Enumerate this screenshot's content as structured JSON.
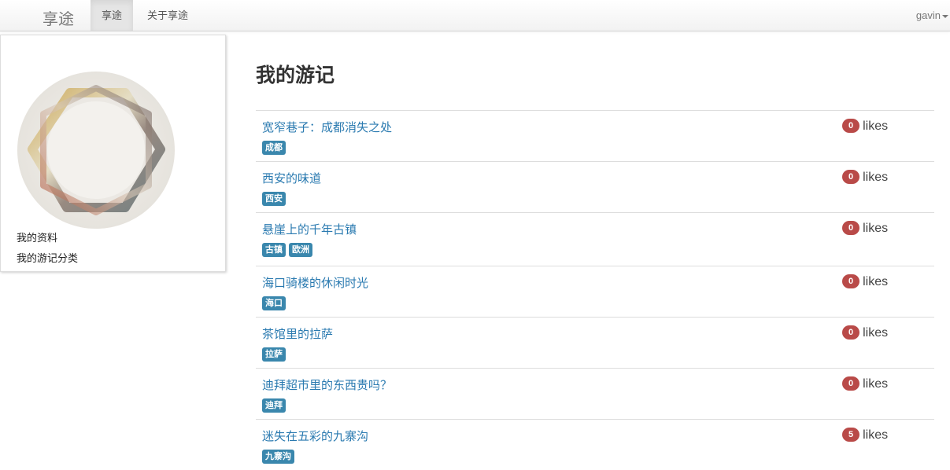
{
  "navbar": {
    "brand": "享途",
    "items": [
      {
        "label": "享途",
        "active": true
      },
      {
        "label": "关于享途",
        "active": false
      }
    ],
    "user": "gavin"
  },
  "sidebar": {
    "links": [
      "我的资料",
      "我的游记分类"
    ]
  },
  "main": {
    "title": "我的游记",
    "likes_label": "likes",
    "posts": [
      {
        "title": "宽窄巷子：成都消失之处",
        "tags": [
          "成都"
        ],
        "likes": "0"
      },
      {
        "title": "西安的味道",
        "tags": [
          "西安"
        ],
        "likes": "0"
      },
      {
        "title": "悬崖上的千年古镇",
        "tags": [
          "古镇",
          "欧洲"
        ],
        "likes": "0"
      },
      {
        "title": "海口骑楼的休闲时光",
        "tags": [
          "海口"
        ],
        "likes": "0"
      },
      {
        "title": "茶馆里的拉萨",
        "tags": [
          "拉萨"
        ],
        "likes": "0"
      },
      {
        "title": "迪拜超市里的东西贵吗？",
        "tags": [
          "迪拜"
        ],
        "likes": "0"
      },
      {
        "title": "迷失在五彩的九寨沟",
        "tags": [
          "九寨沟"
        ],
        "likes": "5"
      }
    ]
  },
  "colors": {
    "link": "#2a7ab0",
    "tag": "#3a87ad",
    "badge": "#b94a48"
  }
}
